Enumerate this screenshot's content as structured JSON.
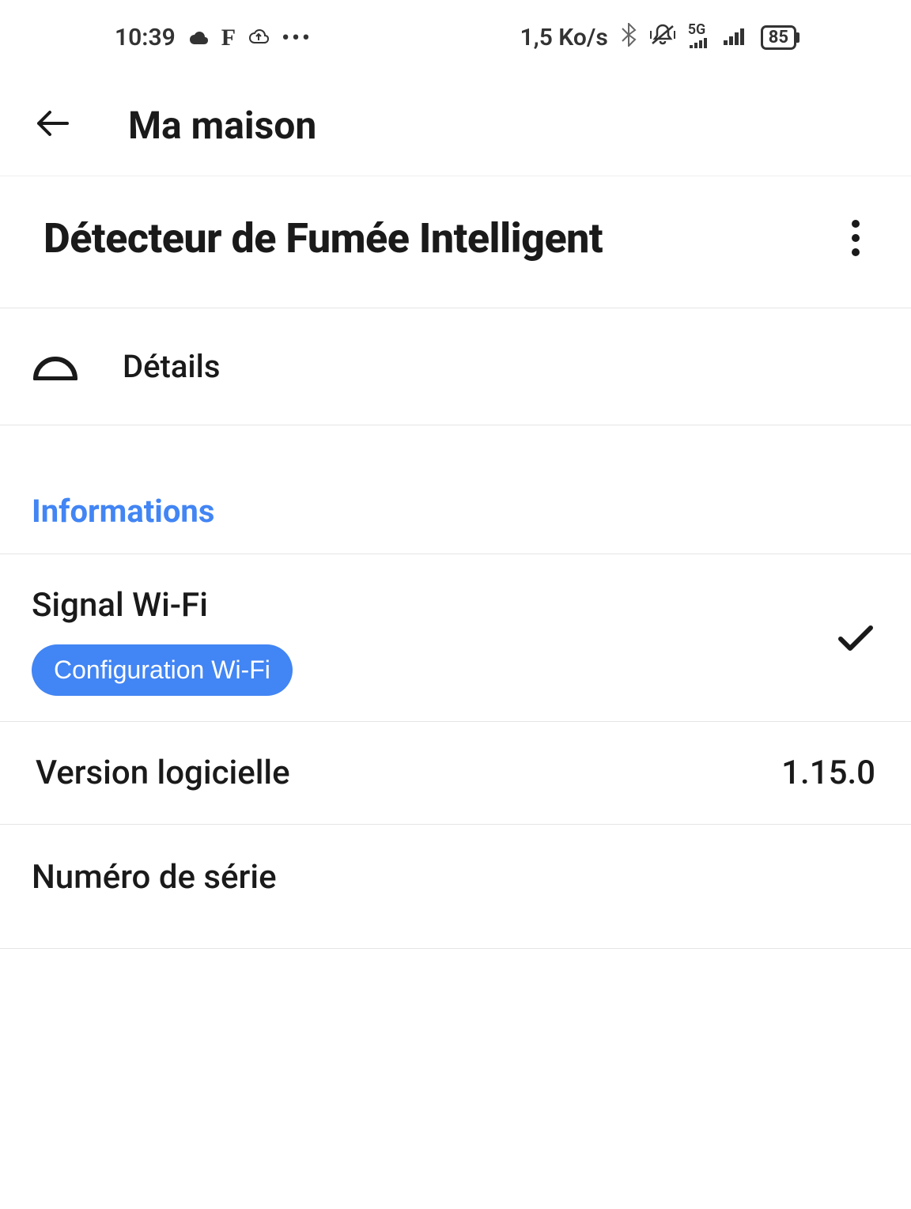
{
  "status_bar": {
    "time": "10:39",
    "data_rate": "1,5 Ko/s",
    "network_type": "5G",
    "battery": "85"
  },
  "header": {
    "title": "Ma maison"
  },
  "device": {
    "name": "Détecteur de Fumée Intelligent"
  },
  "details": {
    "label": "Détails"
  },
  "informations": {
    "section_title": "Informations",
    "wifi_signal_label": "Signal Wi-Fi",
    "wifi_config_button": "Configuration Wi-Fi",
    "software_version_label": "Version logicielle",
    "software_version_value": "1.15.0",
    "serial_number_label": "Numéro de série",
    "serial_number_value": ""
  }
}
